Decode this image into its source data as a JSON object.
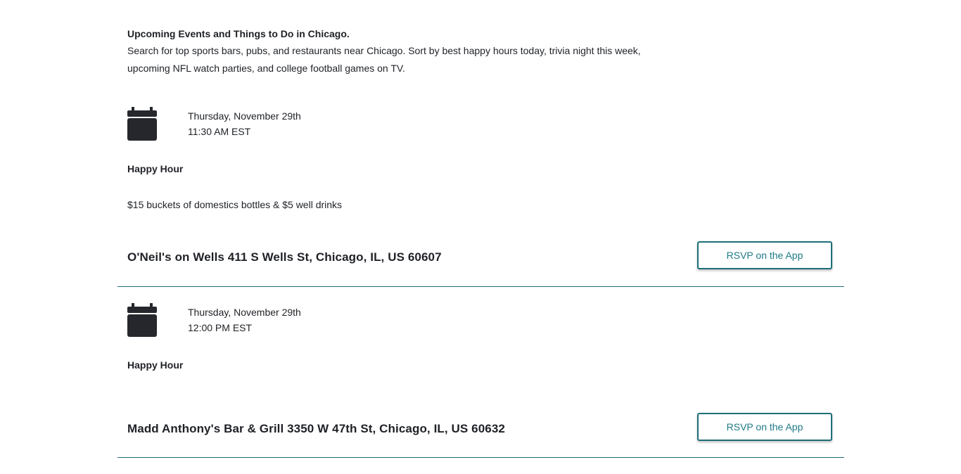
{
  "intro": {
    "title": "Upcoming Events and Things to Do in Chicago.",
    "text": "Search for top sports bars, pubs, and restaurants near Chicago. Sort by best happy hours today, trivia night this week, upcoming NFL watch parties, and college football games on TV."
  },
  "events": [
    {
      "icon": "calendar-icon",
      "date": "Thursday, November 29th",
      "time": "11:30 AM EST",
      "type": "Happy Hour",
      "description": "$15 buckets of domestics bottles & $5 well drinks",
      "venue": "O'Neil's on Wells 411 S Wells St, Chicago, IL, US 60607",
      "rsvp_label": "RSVP on the App"
    },
    {
      "icon": "calendar-icon",
      "date": "Thursday, November 29th",
      "time": "12:00 PM EST",
      "type": "Happy Hour",
      "description": "",
      "venue": "Madd Anthony's Bar & Grill 3350 W 47th St, Chicago, IL, US 60632",
      "rsvp_label": "RSVP on the App"
    }
  ],
  "colors": {
    "accent": "#1e6f78",
    "text": "#1f2126",
    "icon": "#25272d"
  }
}
